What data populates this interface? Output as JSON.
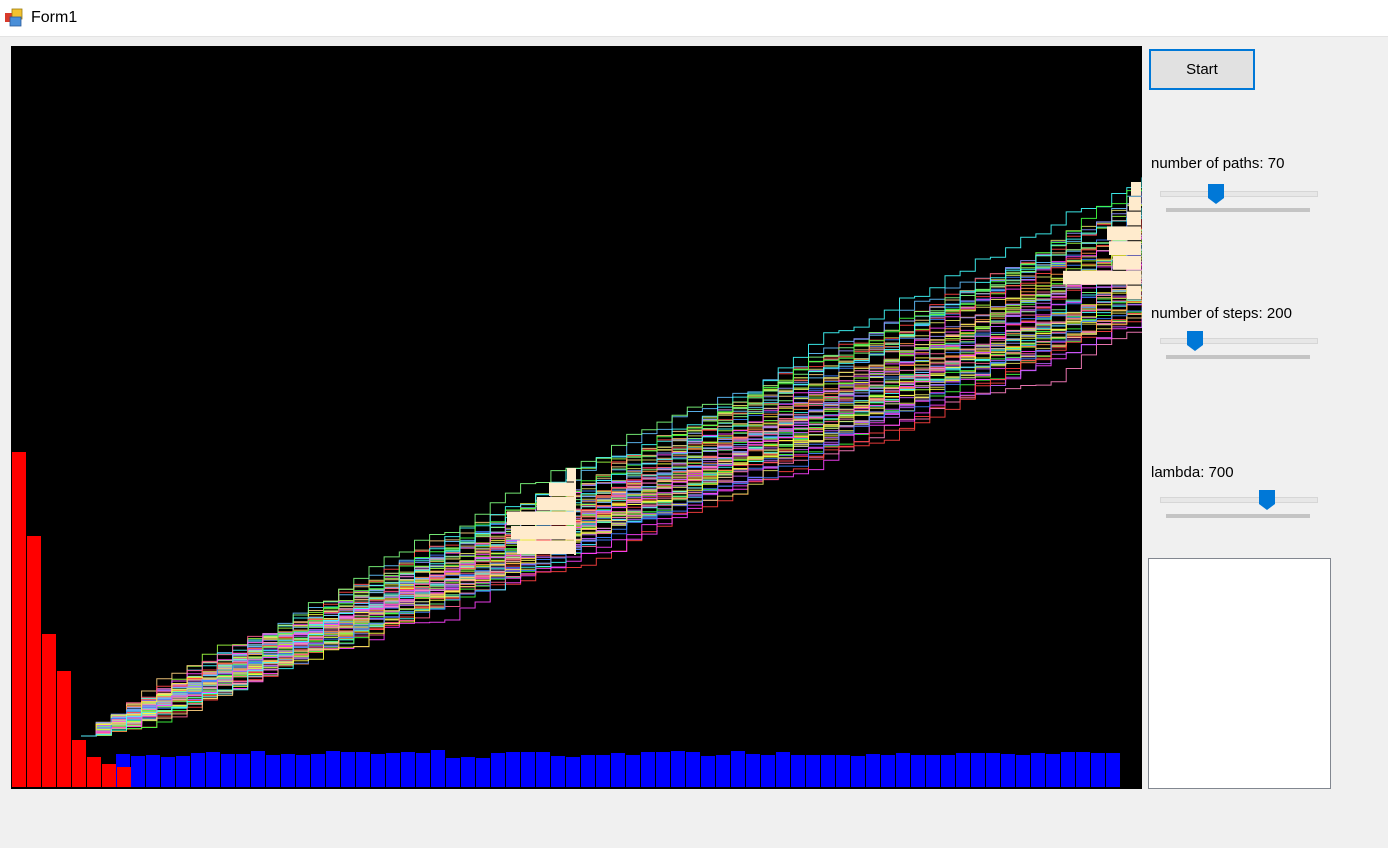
{
  "window": {
    "title": "Form1",
    "icon": "winforms-app-icon"
  },
  "controls": {
    "start_label": "Start",
    "paths": {
      "label": "number of paths: 70",
      "value": 70,
      "min": 0,
      "max": 200
    },
    "steps": {
      "label": "number of steps: 200",
      "value": 200,
      "min": 0,
      "max": 1000
    },
    "lambda": {
      "label": "lambda: 700",
      "value": 700,
      "min": 0,
      "max": 1000
    }
  },
  "chart_data": {
    "type": "line",
    "description_colors": {
      "background": "#000000",
      "left_histogram": "#ff0000",
      "bottom_histogram": "#0000ff",
      "side_histograms": "#ffebcd"
    },
    "paths_count": 70,
    "steps_count": 200,
    "left_histogram_heights": [
      335,
      251,
      153,
      116,
      47,
      30,
      23,
      20
    ],
    "bottom_histogram_heights": [
      33,
      31,
      32,
      30,
      31,
      34,
      35,
      33,
      33,
      36,
      32,
      33,
      32,
      33,
      36,
      35,
      35,
      33,
      34,
      35,
      34,
      37,
      29,
      30,
      29,
      34,
      35,
      35,
      35,
      31,
      30,
      32,
      32,
      34,
      32,
      35,
      35,
      36,
      35,
      31,
      32,
      36,
      33,
      32,
      35,
      32,
      32,
      32,
      32,
      31,
      33,
      32,
      34,
      32,
      32,
      32,
      34,
      34,
      34,
      33,
      32,
      34,
      33,
      35,
      35,
      34,
      34
    ],
    "mid_histogram_widths": [
      8,
      26,
      38,
      68,
      64,
      58
    ],
    "end_histogram_widths": [
      10,
      12,
      14,
      34,
      32,
      28,
      78,
      14
    ]
  }
}
